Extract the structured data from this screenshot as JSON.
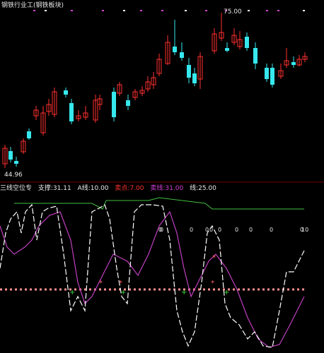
{
  "price_panel": {
    "title": "钢铁行业工(钢铁板块)",
    "high_label": "75.00",
    "low_label": "44.96",
    "bull_color": "#ff3030",
    "bear_color": "#36e8ee"
  },
  "indicator_panel": {
    "legend": [
      {
        "text": "三线空位专",
        "color": "#e8e8e8"
      },
      {
        "text": "支撑:31.11",
        "color": "#e8e8e8"
      },
      {
        "text": "A线:10.00",
        "color": "#e8e8e8"
      },
      {
        "text": "卖点:7.00",
        "color": "#ff3030"
      },
      {
        "text": "卖线:31.00",
        "color": "#d040d0"
      },
      {
        "text": "线:25.00",
        "color": "#e8e8e8"
      }
    ],
    "mid_labels": [
      "0",
      "0",
      "0",
      "0",
      "0",
      "0",
      "0",
      "0",
      "0",
      "0",
      "10"
    ],
    "white_line_color": "#ffffff",
    "magenta_line_color": "#c040c0",
    "green_line_color": "#40c040",
    "support_dots_color": "#ff9090"
  }
}
